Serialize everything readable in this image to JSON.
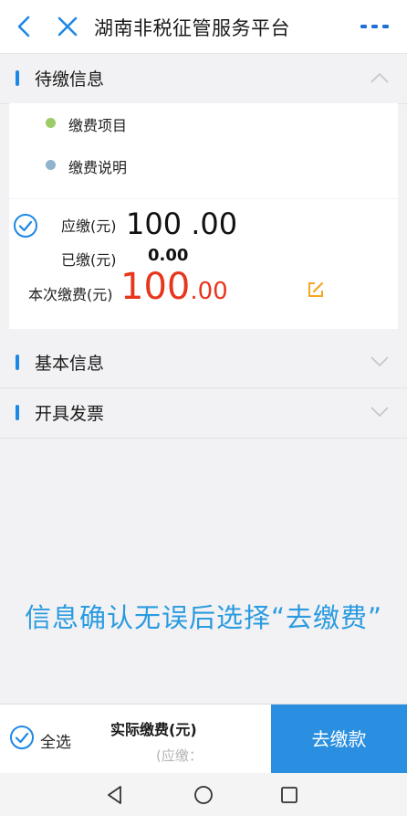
{
  "header": {
    "title": "湖南非税征管服务平台",
    "back_icon": "chevron-left-icon",
    "close_icon": "close-icon",
    "more_icon": "more-dots-icon",
    "accent": "#1e88e5"
  },
  "sections": {
    "pending": {
      "label": "待缴信息",
      "expanded": true
    },
    "basic": {
      "label": "基本信息",
      "expanded": false
    },
    "invoice": {
      "label": "开具发票",
      "expanded": false
    }
  },
  "items": [
    {
      "label": "缴费项目",
      "dot_color": "#9ccc65"
    },
    {
      "label": "缴费说明",
      "dot_color": "#90b4cc"
    }
  ],
  "amounts": {
    "due_label": "应缴(元)",
    "due_value": "100 .00",
    "paid_label": "已缴(元)",
    "paid_value": "0.00",
    "current_label": "本次缴费(元)",
    "current_int": "100",
    "current_dec": ".00",
    "current_color": "#e8361d"
  },
  "hint": "信息确认无误后选择“去缴费”",
  "footer": {
    "select_all": "全选",
    "actual_label": "实际缴费(元)",
    "due_sub": "(应缴：",
    "pay_button": "去缴款",
    "pay_color": "#2a8fe0"
  },
  "system_nav": {
    "back_icon": "triangle-back-icon",
    "home_icon": "circle-home-icon",
    "recents_icon": "square-recents-icon"
  }
}
